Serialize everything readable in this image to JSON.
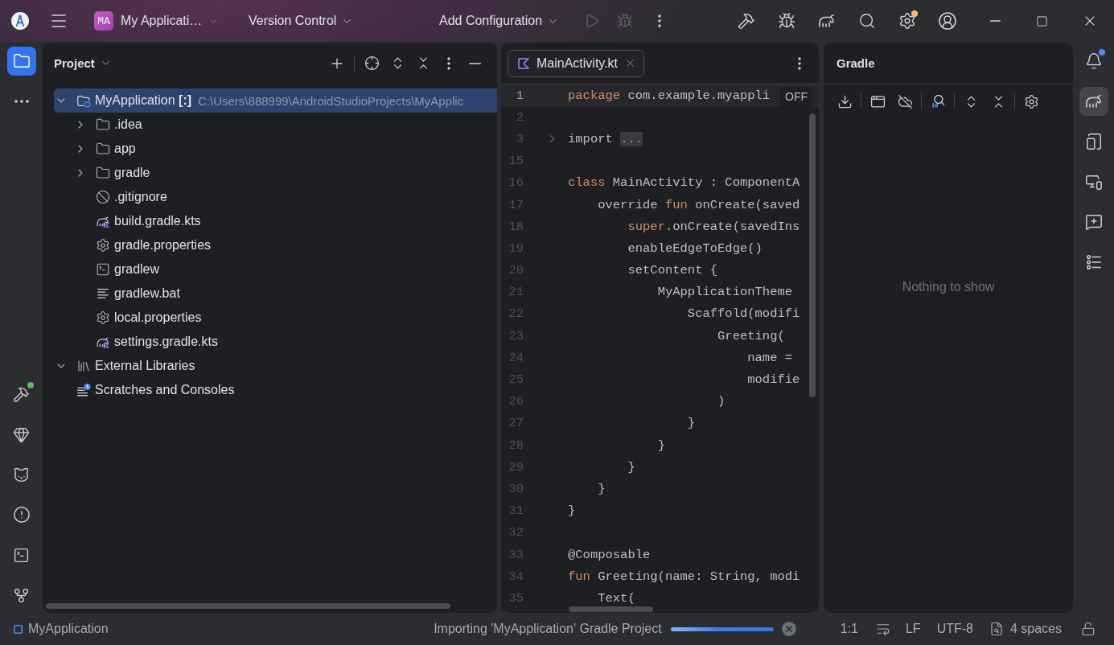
{
  "title_bar": {
    "project": {
      "badge": "MA",
      "name": "My Applicati…"
    },
    "version_control": "Version Control",
    "run_configuration": "Add Configuration",
    "run_actions": [
      {
        "kind": "run",
        "disabled": true
      },
      {
        "kind": "debug",
        "disabled": true
      },
      {
        "kind": "more",
        "disabled": false
      }
    ],
    "tools": [
      {
        "kind": "build_run",
        "badge": false
      },
      {
        "kind": "attach_debugger",
        "badge": false
      },
      {
        "kind": "gradle_sync",
        "badge": false
      },
      {
        "kind": "search",
        "badge": false
      },
      {
        "kind": "settings",
        "badge": true
      },
      {
        "kind": "account",
        "badge": false
      }
    ]
  },
  "left_strip": {
    "top": [
      {
        "kind": "project",
        "selected": true
      },
      {
        "kind": "more",
        "selected": false
      }
    ],
    "bottom": [
      {
        "kind": "build",
        "selected": false,
        "badge": true
      },
      {
        "kind": "gem",
        "selected": false,
        "badge": false
      },
      {
        "kind": "cat",
        "selected": false,
        "badge": false
      },
      {
        "kind": "problems",
        "selected": false,
        "badge": false
      },
      {
        "kind": "terminal",
        "selected": false,
        "badge": false
      },
      {
        "kind": "git",
        "selected": false,
        "badge": false
      }
    ]
  },
  "project_panel": {
    "title": "Project",
    "tree": [
      {
        "kind": "module",
        "name": "MyApplication **[:]**",
        "path": "C:\\Users\\888999\\AndroidStudioProjects\\MyApplic",
        "expanded": true,
        "selected": true,
        "children": [
          {
            "kind": "folder",
            "name": ".idea",
            "expanded": false,
            "selected": false
          },
          {
            "kind": "folder",
            "name": "app",
            "expanded": false,
            "selected": false
          },
          {
            "kind": "folder",
            "name": "gradle",
            "expanded": false,
            "selected": false
          },
          {
            "kind": "ignore_file",
            "name": ".gitignore",
            "selected": false
          },
          {
            "kind": "gradle_script",
            "name": "build.gradle.kts",
            "selected": false
          },
          {
            "kind": "properties",
            "name": "gradle.properties",
            "selected": false
          },
          {
            "kind": "shell_script",
            "name": "gradlew",
            "selected": false
          },
          {
            "kind": "text_file",
            "name": "gradlew.bat",
            "selected": false
          },
          {
            "kind": "properties",
            "name": "local.properties",
            "selected": false
          },
          {
            "kind": "gradle_script",
            "name": "settings.gradle.kts",
            "selected": false
          }
        ]
      },
      {
        "kind": "libraries",
        "name": "External Libraries",
        "expanded": true,
        "selected": false
      },
      {
        "kind": "scratches",
        "name": "Scratches and Consoles",
        "selected": false
      }
    ]
  },
  "editor": {
    "tabs": [
      {
        "label": "MainActivity.kt",
        "selected": true
      }
    ],
    "inlay_label": "OFF",
    "lines": [
      {
        "number": "1",
        "current": true,
        "tokens": [
          {
            "kind": "keyword",
            "text": "package"
          },
          {
            "kind": "plain",
            "text": " com.example.myappli"
          }
        ]
      },
      {
        "number": "2",
        "current": false
      },
      {
        "number": "3",
        "current": false,
        "fold_marker": true,
        "tokens": [
          {
            "kind": "plain",
            "text": "import "
          },
          {
            "kind": "fold",
            "text": "..."
          }
        ]
      },
      {
        "number": "15",
        "current": false
      },
      {
        "number": "16",
        "current": false,
        "tokens": [
          {
            "kind": "keyword",
            "text": "class"
          },
          {
            "kind": "plain",
            "text": " MainActivity : ComponentA"
          }
        ]
      },
      {
        "number": "17",
        "current": false,
        "tokens": [
          {
            "kind": "plain",
            "text": "    override "
          },
          {
            "kind": "keyword",
            "text": "fun"
          },
          {
            "kind": "plain",
            "text": " onCreate(saved"
          }
        ]
      },
      {
        "number": "18",
        "current": false,
        "tokens": [
          {
            "kind": "keyword",
            "text": "        super"
          },
          {
            "kind": "plain",
            "text": ".onCreate(savedIns"
          }
        ]
      },
      {
        "number": "19",
        "current": false,
        "tokens": [
          {
            "kind": "plain",
            "text": "        enableEdgeToEdge()"
          }
        ]
      },
      {
        "number": "20",
        "current": false,
        "tokens": [
          {
            "kind": "plain",
            "text": "        setContent {"
          }
        ]
      },
      {
        "number": "21",
        "current": false,
        "tokens": [
          {
            "kind": "plain",
            "text": "            MyApplicationTheme"
          }
        ]
      },
      {
        "number": "22",
        "current": false,
        "tokens": [
          {
            "kind": "plain",
            "text": "                Scaffold(modifi"
          }
        ]
      },
      {
        "number": "23",
        "current": false,
        "tokens": [
          {
            "kind": "plain",
            "text": "                    Greeting("
          }
        ]
      },
      {
        "number": "24",
        "current": false,
        "tokens": [
          {
            "kind": "plain",
            "text": "                        name ="
          }
        ]
      },
      {
        "number": "25",
        "current": false,
        "tokens": [
          {
            "kind": "plain",
            "text": "                        modifie"
          }
        ]
      },
      {
        "number": "26",
        "current": false,
        "tokens": [
          {
            "kind": "plain",
            "text": "                    )"
          }
        ]
      },
      {
        "number": "27",
        "current": false,
        "tokens": [
          {
            "kind": "plain",
            "text": "                }"
          }
        ]
      },
      {
        "number": "28",
        "current": false,
        "tokens": [
          {
            "kind": "plain",
            "text": "            }"
          }
        ]
      },
      {
        "number": "29",
        "current": false,
        "tokens": [
          {
            "kind": "plain",
            "text": "        }"
          }
        ]
      },
      {
        "number": "30",
        "current": false,
        "tokens": [
          {
            "kind": "plain",
            "text": "    }"
          }
        ]
      },
      {
        "number": "31",
        "current": false,
        "tokens": [
          {
            "kind": "plain",
            "text": "}"
          }
        ]
      },
      {
        "number": "32",
        "current": false
      },
      {
        "number": "33",
        "current": false,
        "tokens": [
          {
            "kind": "plain",
            "text": "@Composable"
          }
        ]
      },
      {
        "number": "34",
        "current": false,
        "tokens": [
          {
            "kind": "keyword",
            "text": "fun"
          },
          {
            "kind": "plain",
            "text": " Greeting(name: String, modi"
          }
        ]
      },
      {
        "number": "35",
        "current": false,
        "tokens": [
          {
            "kind": "plain",
            "text": "    Text("
          }
        ]
      }
    ]
  },
  "gradle_panel": {
    "title": "Gradle",
    "empty_text": "Nothing to show"
  },
  "right_strip": {
    "items": [
      {
        "kind": "notifications",
        "selected": false,
        "badge": true
      },
      {
        "kind": "gradle",
        "selected": true,
        "badge": false
      },
      {
        "kind": "device_manager",
        "selected": false,
        "badge": false
      },
      {
        "kind": "running_devices",
        "selected": false,
        "badge": false
      },
      {
        "kind": "assistant",
        "selected": false,
        "badge": false
      },
      {
        "kind": "structure",
        "selected": false,
        "badge": false
      }
    ]
  },
  "status_bar": {
    "module": "MyApplication",
    "task": "Importing 'MyApplication' Gradle Project",
    "progress": {
      "level": 1
    },
    "caret_position": "1:1",
    "line_separator": "LF",
    "encoding": "UTF-8",
    "indentation": "4 spaces"
  }
}
